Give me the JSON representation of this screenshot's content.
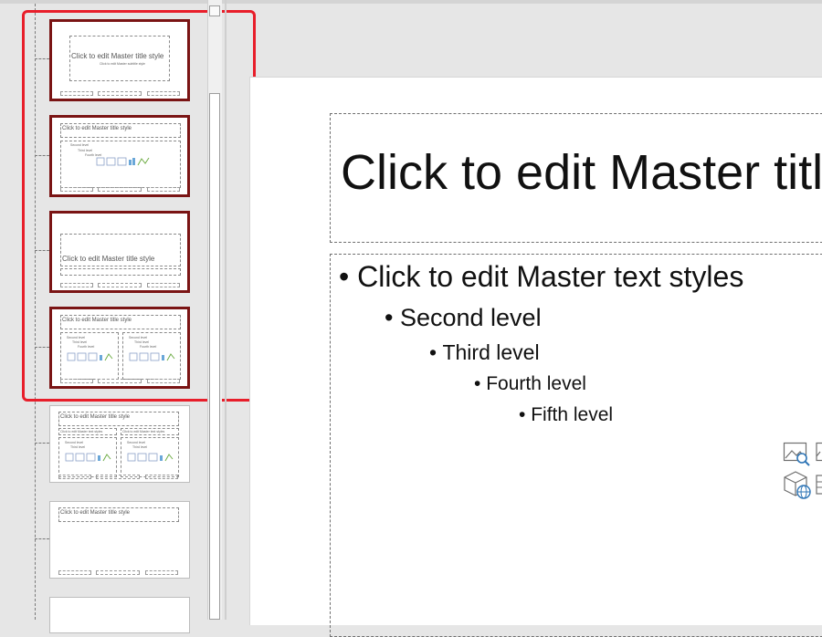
{
  "thumbnails": [
    {
      "title": "Click to edit Master title style",
      "subtitle": "Click to edit Master subtitle style"
    },
    {
      "title": "Click to edit Master title style",
      "body": [
        "Second level",
        "Third level",
        "Fourth level"
      ]
    },
    {
      "title": "Click to edit Master title style"
    },
    {
      "title": "Click to edit Master title style",
      "left_body": [
        "Second level",
        "Third level",
        "Fourth level"
      ],
      "right_body": [
        "Second level",
        "Third level",
        "Fourth level"
      ]
    },
    {
      "title": "Click to edit Master title style",
      "left_heading": "Click to edit Master text styles",
      "right_heading": "Click to edit Master text styles",
      "left_body": [
        "Second level",
        "Third level"
      ],
      "right_body": [
        "Second level",
        "Third level"
      ]
    },
    {
      "title": "Click to edit Master title style"
    }
  ],
  "slide": {
    "title": "Click to edit Master title style",
    "levels": [
      "Click to edit Master text styles",
      "Second level",
      "Third level",
      "Fourth level",
      "Fifth level"
    ]
  },
  "icons": {
    "search_picture": "online-picture-icon",
    "picture": "picture-icon",
    "model_3d": "3d-model-icon",
    "table": "table-icon"
  },
  "colors": {
    "selected_border": "#7a1414",
    "highlight": "#e81e2a"
  }
}
